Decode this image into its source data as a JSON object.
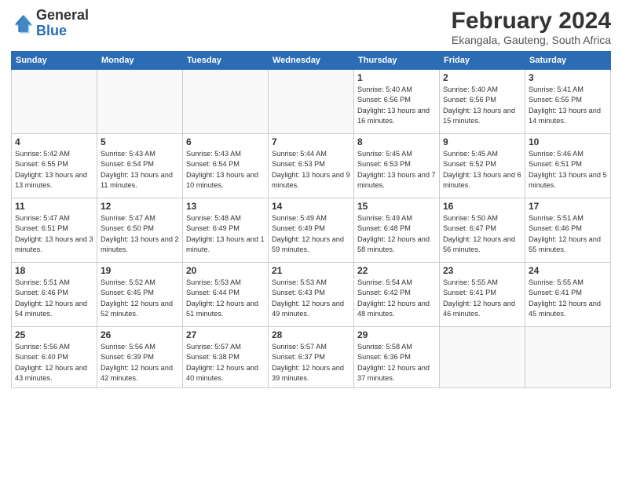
{
  "header": {
    "logo_general": "General",
    "logo_blue": "Blue",
    "month": "February 2024",
    "location": "Ekangala, Gauteng, South Africa"
  },
  "weekdays": [
    "Sunday",
    "Monday",
    "Tuesday",
    "Wednesday",
    "Thursday",
    "Friday",
    "Saturday"
  ],
  "weeks": [
    [
      {
        "day": "",
        "info": ""
      },
      {
        "day": "",
        "info": ""
      },
      {
        "day": "",
        "info": ""
      },
      {
        "day": "",
        "info": ""
      },
      {
        "day": "1",
        "info": "Sunrise: 5:40 AM\nSunset: 6:56 PM\nDaylight: 13 hours\nand 16 minutes."
      },
      {
        "day": "2",
        "info": "Sunrise: 5:40 AM\nSunset: 6:56 PM\nDaylight: 13 hours\nand 15 minutes."
      },
      {
        "day": "3",
        "info": "Sunrise: 5:41 AM\nSunset: 6:55 PM\nDaylight: 13 hours\nand 14 minutes."
      }
    ],
    [
      {
        "day": "4",
        "info": "Sunrise: 5:42 AM\nSunset: 6:55 PM\nDaylight: 13 hours\nand 13 minutes."
      },
      {
        "day": "5",
        "info": "Sunrise: 5:43 AM\nSunset: 6:54 PM\nDaylight: 13 hours\nand 11 minutes."
      },
      {
        "day": "6",
        "info": "Sunrise: 5:43 AM\nSunset: 6:54 PM\nDaylight: 13 hours\nand 10 minutes."
      },
      {
        "day": "7",
        "info": "Sunrise: 5:44 AM\nSunset: 6:53 PM\nDaylight: 13 hours\nand 9 minutes."
      },
      {
        "day": "8",
        "info": "Sunrise: 5:45 AM\nSunset: 6:53 PM\nDaylight: 13 hours\nand 7 minutes."
      },
      {
        "day": "9",
        "info": "Sunrise: 5:45 AM\nSunset: 6:52 PM\nDaylight: 13 hours\nand 6 minutes."
      },
      {
        "day": "10",
        "info": "Sunrise: 5:46 AM\nSunset: 6:51 PM\nDaylight: 13 hours\nand 5 minutes."
      }
    ],
    [
      {
        "day": "11",
        "info": "Sunrise: 5:47 AM\nSunset: 6:51 PM\nDaylight: 13 hours\nand 3 minutes."
      },
      {
        "day": "12",
        "info": "Sunrise: 5:47 AM\nSunset: 6:50 PM\nDaylight: 13 hours\nand 2 minutes."
      },
      {
        "day": "13",
        "info": "Sunrise: 5:48 AM\nSunset: 6:49 PM\nDaylight: 13 hours\nand 1 minute."
      },
      {
        "day": "14",
        "info": "Sunrise: 5:49 AM\nSunset: 6:49 PM\nDaylight: 12 hours\nand 59 minutes."
      },
      {
        "day": "15",
        "info": "Sunrise: 5:49 AM\nSunset: 6:48 PM\nDaylight: 12 hours\nand 58 minutes."
      },
      {
        "day": "16",
        "info": "Sunrise: 5:50 AM\nSunset: 6:47 PM\nDaylight: 12 hours\nand 56 minutes."
      },
      {
        "day": "17",
        "info": "Sunrise: 5:51 AM\nSunset: 6:46 PM\nDaylight: 12 hours\nand 55 minutes."
      }
    ],
    [
      {
        "day": "18",
        "info": "Sunrise: 5:51 AM\nSunset: 6:46 PM\nDaylight: 12 hours\nand 54 minutes."
      },
      {
        "day": "19",
        "info": "Sunrise: 5:52 AM\nSunset: 6:45 PM\nDaylight: 12 hours\nand 52 minutes."
      },
      {
        "day": "20",
        "info": "Sunrise: 5:53 AM\nSunset: 6:44 PM\nDaylight: 12 hours\nand 51 minutes."
      },
      {
        "day": "21",
        "info": "Sunrise: 5:53 AM\nSunset: 6:43 PM\nDaylight: 12 hours\nand 49 minutes."
      },
      {
        "day": "22",
        "info": "Sunrise: 5:54 AM\nSunset: 6:42 PM\nDaylight: 12 hours\nand 48 minutes."
      },
      {
        "day": "23",
        "info": "Sunrise: 5:55 AM\nSunset: 6:41 PM\nDaylight: 12 hours\nand 46 minutes."
      },
      {
        "day": "24",
        "info": "Sunrise: 5:55 AM\nSunset: 6:41 PM\nDaylight: 12 hours\nand 45 minutes."
      }
    ],
    [
      {
        "day": "25",
        "info": "Sunrise: 5:56 AM\nSunset: 6:40 PM\nDaylight: 12 hours\nand 43 minutes."
      },
      {
        "day": "26",
        "info": "Sunrise: 5:56 AM\nSunset: 6:39 PM\nDaylight: 12 hours\nand 42 minutes."
      },
      {
        "day": "27",
        "info": "Sunrise: 5:57 AM\nSunset: 6:38 PM\nDaylight: 12 hours\nand 40 minutes."
      },
      {
        "day": "28",
        "info": "Sunrise: 5:57 AM\nSunset: 6:37 PM\nDaylight: 12 hours\nand 39 minutes."
      },
      {
        "day": "29",
        "info": "Sunrise: 5:58 AM\nSunset: 6:36 PM\nDaylight: 12 hours\nand 37 minutes."
      },
      {
        "day": "",
        "info": ""
      },
      {
        "day": "",
        "info": ""
      }
    ]
  ]
}
